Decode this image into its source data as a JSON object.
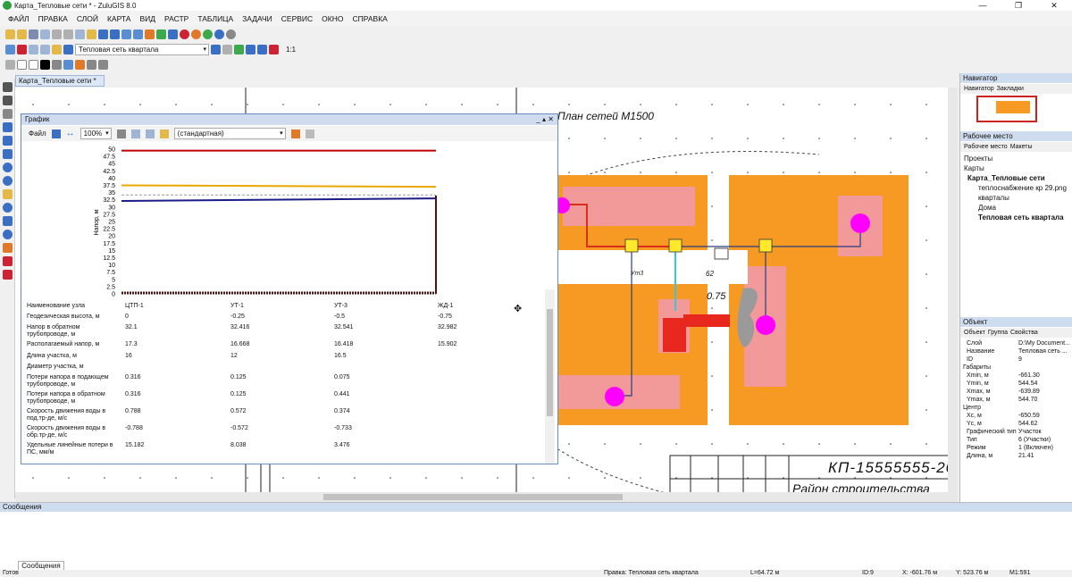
{
  "window": {
    "title": "Карта_Тепловые сети * - ZuluGIS 8.0",
    "minimize": "—",
    "maximize": "❐",
    "close": "✕"
  },
  "menu": [
    "ФАЙЛ",
    "ПРАВКА",
    "СЛОЙ",
    "КАРТА",
    "ВИД",
    "РАСТР",
    "ТАБЛИЦА",
    "ЗАДАЧИ",
    "СЕРВИС",
    "ОКНО",
    "СПРАВКА"
  ],
  "toolbar": {
    "layer_select": "Тепловая сеть квартала",
    "scale_label": "1:1"
  },
  "doc_tab": "Карта_Тепловые сети *",
  "map": {
    "plan_title": "План сетей М1500",
    "stamp_code": "КП-15555555-20",
    "stamp_subtitle": "Район строительства",
    "label_075": "0.75",
    "label_062": "62"
  },
  "graph": {
    "title": "График",
    "file_menu": "Файл",
    "zoom": "100%",
    "style": "(стандартная)",
    "row_header": "Наименование узла",
    "nodes": [
      "ЦТП-1",
      "УТ-1",
      "УТ-3",
      "ЖД-1"
    ],
    "rows": [
      {
        "label": "Геодезическая высота, м",
        "values": [
          "0",
          "-0.25",
          "-0.5",
          "-0.75"
        ]
      },
      {
        "label": "Напор в обратном трубопроводе, м",
        "values": [
          "32.1",
          "32.416",
          "32.541",
          "32.982"
        ]
      },
      {
        "label": "Располагаемый напор, м",
        "values": [
          "17.3",
          "16.668",
          "16.418",
          "15.902"
        ]
      },
      {
        "label": "Длина участка, м",
        "values": [
          "16",
          "12",
          "16.5",
          ""
        ]
      },
      {
        "label": "Диаметр участка, м",
        "values": [
          "",
          "",
          "",
          ""
        ]
      },
      {
        "label": "Потери напора в подающем трубопроводе, м",
        "values": [
          "0.316",
          "0.125",
          "0.075",
          ""
        ]
      },
      {
        "label": "Потери напора в обратном трубопроводе, м",
        "values": [
          "0.316",
          "0.125",
          "0.441",
          ""
        ]
      },
      {
        "label": "Скорость движения воды в под.тр-де, м/с",
        "values": [
          "0.788",
          "0.572",
          "0.374",
          ""
        ]
      },
      {
        "label": "Скорость движения воды в обр.тр-де, м/с",
        "values": [
          "-0.788",
          "-0.572",
          "-0.733",
          ""
        ]
      },
      {
        "label": "Удельные линейные потери в ПС, мм/м",
        "values": [
          "15.182",
          "8.038",
          "3.476",
          ""
        ]
      }
    ]
  },
  "chart_data": {
    "type": "line",
    "ylabel": "Напор, м",
    "ylim": [
      0,
      50
    ],
    "yticks": [
      "0",
      "2.5",
      "5",
      "7.5",
      "10",
      "12.5",
      "15",
      "17.5",
      "20",
      "22.5",
      "25",
      "27.5",
      "30",
      "32.5",
      "35",
      "37.5",
      "40",
      "42.5",
      "45",
      "47.5",
      "50"
    ],
    "series": [
      {
        "color": "#c00000",
        "values": [
          49.5,
          49.5
        ]
      },
      {
        "color": "#e8a800",
        "values": [
          37.5,
          37.0
        ]
      },
      {
        "color": "#1b1b8a",
        "values": [
          32.1,
          33.0
        ]
      },
      {
        "color": "#999999",
        "dashed": true,
        "values": [
          34.2,
          34.2
        ]
      }
    ],
    "ground_line": {
      "color": "#4a1414",
      "values": [
        0,
        -0.75
      ]
    }
  },
  "navigator": {
    "title": "Навигатор",
    "tab1": "Навигатор",
    "tab2": "Закладки"
  },
  "workspace": {
    "title": "Рабочее место",
    "tab1": "Рабочее место",
    "tab2": "Макеты",
    "items": [
      "Проекты",
      "Карты",
      "Карта_Тепловые сети",
      "теплоснабжение кр 29.png",
      "кварталы",
      "Дома",
      "Тепловая сеть квартала"
    ]
  },
  "object": {
    "title": "Объект",
    "tab1": "Объект",
    "tab2": "Группа",
    "tab3": "Свойства",
    "props": [
      [
        "Слой",
        "D:\\My Document..."
      ],
      [
        "Название",
        "Тепловая сеть ..."
      ],
      [
        "ID",
        "9"
      ],
      [
        "Габариты",
        ""
      ],
      [
        "Xmin, м",
        "-661.30"
      ],
      [
        "Ymin, м",
        "544.54"
      ],
      [
        "Xmax, м",
        "-639.89"
      ],
      [
        "Ymax, м",
        "544.70"
      ],
      [
        "Центр",
        ""
      ],
      [
        "Xc, м",
        "-650.59"
      ],
      [
        "Yc, м",
        "544.62"
      ],
      [
        "Графический тип",
        "Участок"
      ],
      [
        "Тип",
        "6 (Участки)"
      ],
      [
        "Режим",
        "1 (Включен)"
      ],
      [
        "Длина, м",
        "21.41"
      ]
    ]
  },
  "messages": {
    "title": "Сообщения",
    "tab": "Сообщения"
  },
  "status": {
    "ready": "Готов",
    "edit": "Правка: Тепловая сеть квартала",
    "length": "L=64.72 м",
    "id": "ID:9",
    "x": "X: -601.76 м",
    "y": "Y: 523.76 м",
    "scale": "M1:591"
  },
  "colors": {
    "orange": "#f79a24",
    "pink": "#f29a9a",
    "magenta": "#ff00ff",
    "pipe_red": "#d9301e",
    "pipe_blue": "#2a3f7a",
    "yellow": "#ffe92a"
  }
}
